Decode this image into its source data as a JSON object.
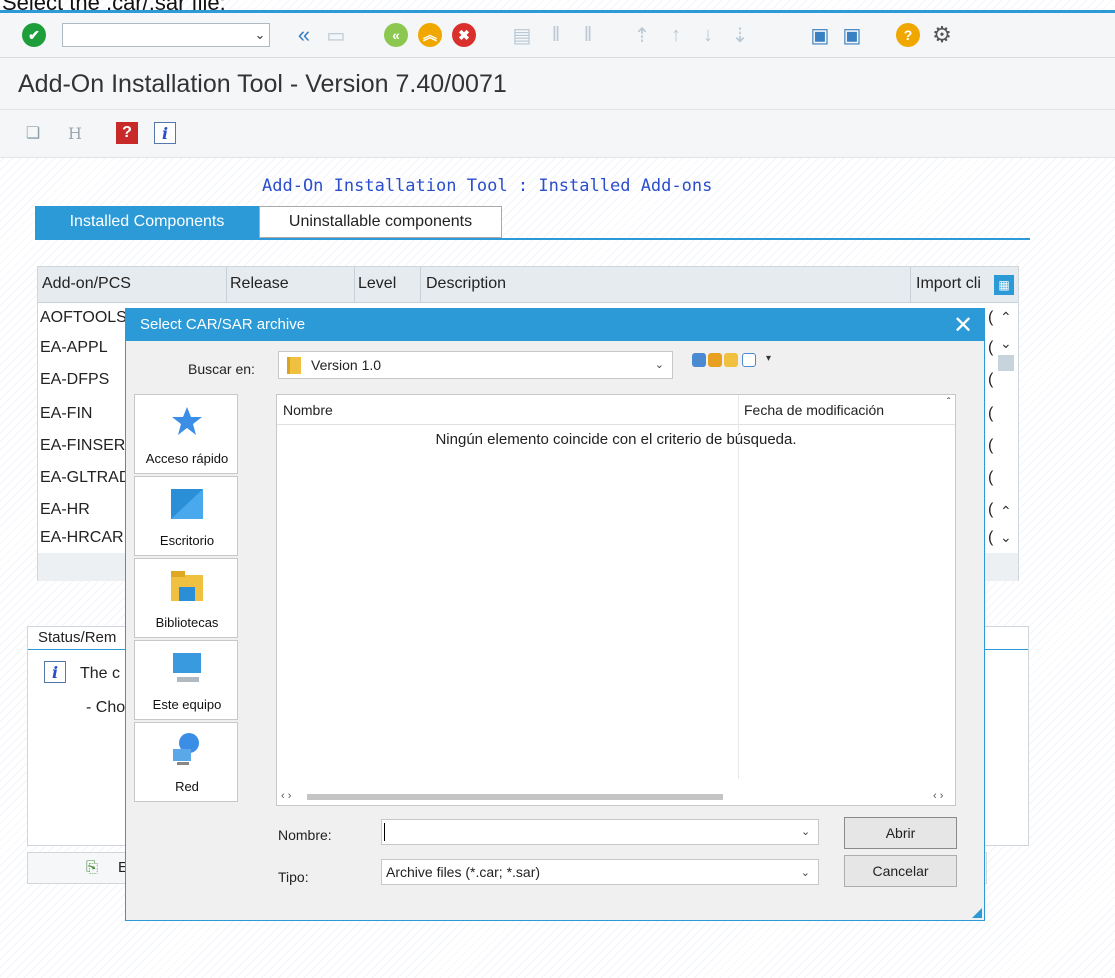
{
  "page": {
    "caption": "Select the .car/.sar file:"
  },
  "window": {
    "title": "Add-On Installation Tool - Version 7.40/0071",
    "headline": "Add-On Installation Tool : Installed Add-ons"
  },
  "tabs": [
    {
      "label": "Installed Components",
      "active": true
    },
    {
      "label": "Uninstallable components",
      "active": false
    }
  ],
  "grid": {
    "columns": [
      "Add-on/PCS",
      "Release",
      "Level",
      "Description",
      "Import cli"
    ],
    "rows": [
      {
        "name": "AOFTOOLS",
        "trail": "("
      },
      {
        "name": "EA-APPL",
        "trail": "("
      },
      {
        "name": "EA-DFPS",
        "trail": "("
      },
      {
        "name": "EA-FIN",
        "trail": "("
      },
      {
        "name": "EA-FINSER",
        "trail": "("
      },
      {
        "name": "EA-GLTRAD",
        "trail": "("
      },
      {
        "name": "EA-HR",
        "trail": "("
      },
      {
        "name": "EA-HRCAR",
        "trail": "("
      }
    ]
  },
  "status": {
    "title": "Status/Rem",
    "line1": "The c",
    "line2": "- Choose"
  },
  "footer": {
    "label": "E"
  },
  "dialog": {
    "title": "Select CAR/SAR archive",
    "look_in_label": "Buscar en:",
    "look_in_value": "Version 1.0",
    "places": [
      "Acceso rápido",
      "Escritorio",
      "Bibliotecas",
      "Este equipo",
      "Red"
    ],
    "columns": [
      "Nombre",
      "Fecha de modificación"
    ],
    "empty_message": "Ningún elemento coincide con el criterio de búsqueda.",
    "name_label": "Nombre:",
    "name_value": "",
    "type_label": "Tipo:",
    "type_value": "Archive files (*.car; *.sar)",
    "open_label": "Abrir",
    "cancel_label": "Cancelar"
  },
  "colors": {
    "accent": "#2b9ad6",
    "headline": "#2a4dcc",
    "ok": "#1e9e3a",
    "cancel": "#d9302c",
    "help": "#f0a800"
  }
}
